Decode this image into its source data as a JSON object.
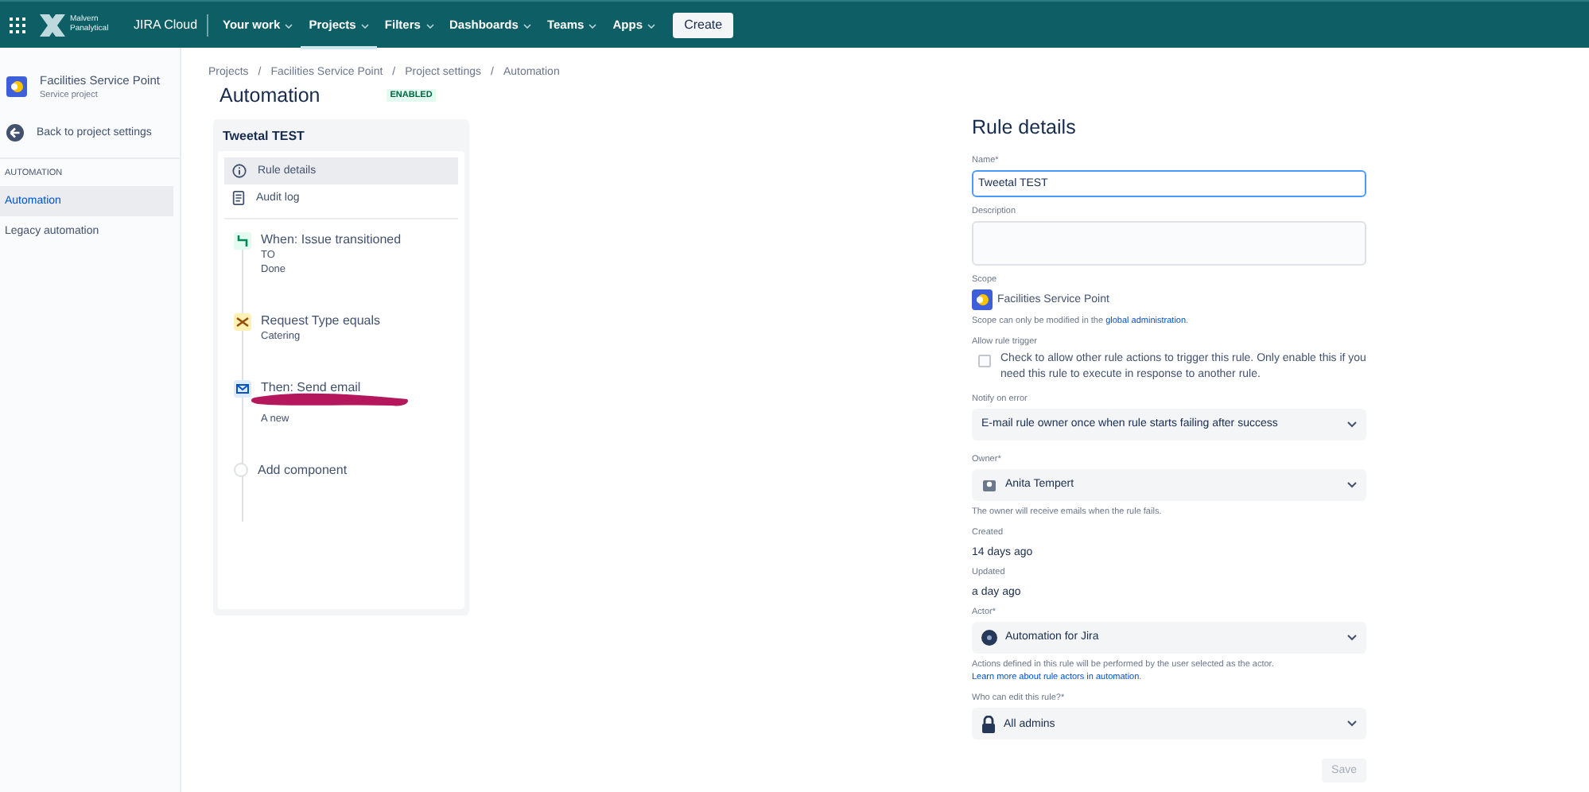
{
  "topbar": {
    "logo_text": "Malvern Panalytical",
    "product": "JIRA Cloud",
    "nav": [
      {
        "label": "Your work",
        "selected": false
      },
      {
        "label": "Projects",
        "selected": true
      },
      {
        "label": "Filters",
        "selected": false
      },
      {
        "label": "Dashboards",
        "selected": false
      },
      {
        "label": "Teams",
        "selected": false
      },
      {
        "label": "Apps",
        "selected": false
      }
    ],
    "create": "Create"
  },
  "sidebar": {
    "project": {
      "name": "Facilities Service Point",
      "type": "Service project"
    },
    "back": "Back to project settings",
    "section": "AUTOMATION",
    "items": [
      {
        "label": "Automation",
        "selected": true
      },
      {
        "label": "Legacy automation",
        "selected": false
      }
    ]
  },
  "breadcrumbs": [
    "Projects",
    "Facilities Service Point",
    "Project settings",
    "Automation"
  ],
  "breadcrumb_separator": "/",
  "page": {
    "title": "Automation",
    "status": "ENABLED"
  },
  "rule_card": {
    "title": "Tweetal TEST",
    "menu": [
      {
        "label": "Rule details",
        "kind": "info",
        "selected": true
      },
      {
        "label": "Audit log",
        "kind": "log",
        "selected": false
      }
    ],
    "components": [
      {
        "kind": "trigger",
        "title": "When: Issue transitioned",
        "lines": [
          "TO",
          "Done"
        ]
      },
      {
        "kind": "condition",
        "title": "Request Type equals",
        "lines": [
          "Catering"
        ]
      },
      {
        "kind": "action",
        "title": "Then: Send email",
        "lines": [
          "A new"
        ],
        "redacted": true
      },
      {
        "kind": "add",
        "title": "Add component"
      }
    ]
  },
  "rule_details": {
    "title": "Rule details",
    "name": {
      "label": "Name*",
      "value": "Tweetal TEST"
    },
    "description": {
      "label": "Description"
    },
    "scope": {
      "label": "Scope",
      "value": "Facilities Service Point",
      "help": "Scope can only be modified in the",
      "link": "global administration",
      "help_end": "."
    },
    "allow_trigger": {
      "label": "Allow rule trigger",
      "checked": false,
      "text": "Check to allow other rule actions to trigger this rule. Only enable this if you need this rule to execute in response to another rule."
    },
    "notify": {
      "label": "Notify on error",
      "value": "E-mail rule owner once when rule starts failing after success"
    },
    "owner": {
      "label": "Owner*",
      "value": "Anita Tempert",
      "help": "The owner will receive emails when the rule fails."
    },
    "created": {
      "label": "Created",
      "value": "14 days ago"
    },
    "updated": {
      "label": "Updated",
      "value": "a day ago"
    },
    "actor": {
      "label": "Actor*",
      "value": "Automation for Jira",
      "help": "Actions defined in this rule will be performed by the user selected as the actor.",
      "link": "Learn more about rule actors in automation",
      "help_end": "."
    },
    "editors": {
      "label": "Who can edit this rule?*",
      "value": "All admins"
    },
    "save": {
      "label": "Save",
      "disabled": true
    }
  }
}
